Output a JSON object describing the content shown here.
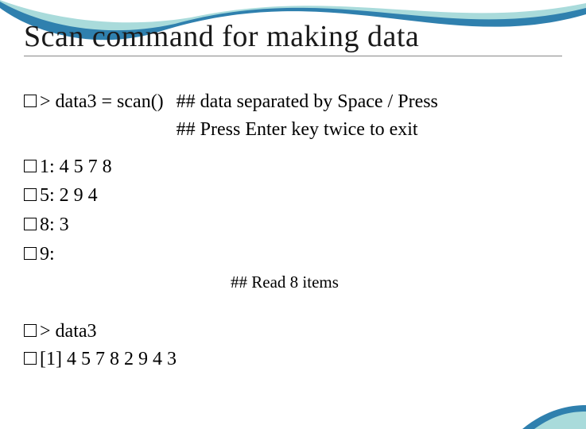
{
  "title": "Scan command for making data",
  "line1_code": "> data3 = scan()",
  "line1_comment1": "## data separated by Space / Press",
  "line1_comment2": "## Press Enter key twice to exit",
  "inputs": {
    "l1": "1: 4 5 7 8",
    "l2": "5: 2 9 4",
    "l3": "8: 3",
    "l4": "9:"
  },
  "read_note": "## Read 8 items",
  "out1": "> data3",
  "out2": "[1] 4 5 7 8 2 9 4 3"
}
